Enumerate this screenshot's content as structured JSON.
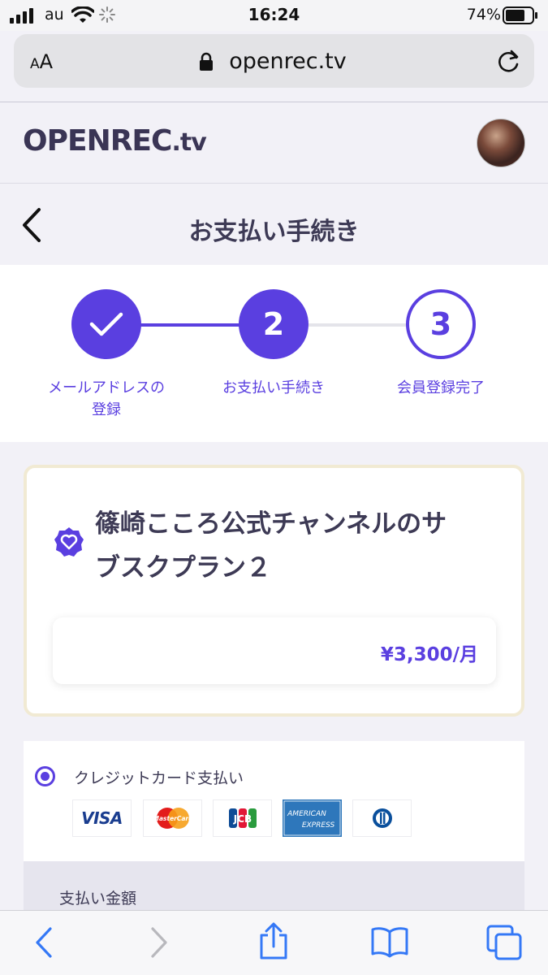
{
  "status_bar": {
    "carrier": "au",
    "time": "16:24",
    "battery_percent": "74%",
    "battery_level": 0.74
  },
  "browser": {
    "text_size_label_small": "A",
    "text_size_label_large": "A",
    "url": "openrec.tv"
  },
  "site": {
    "logo_main": "OPENREC",
    "logo_suffix": ".tv"
  },
  "page": {
    "title": "お支払い手続き"
  },
  "steps": [
    {
      "number": "",
      "label_line1": "メールアドレスの",
      "label_line2": "登録",
      "state": "done"
    },
    {
      "number": "2",
      "label_line1": "お支払い手続き",
      "label_line2": "",
      "state": "current"
    },
    {
      "number": "3",
      "label_line1": "会員登録完了",
      "label_line2": "",
      "state": "todo"
    }
  ],
  "plan": {
    "title_line1": "篠崎こころ公式チャンネルのサ",
    "title_line2": "ブスクプラン２",
    "price": "¥3,300/月"
  },
  "payment": {
    "method_label": "クレジットカード支払い",
    "cards": [
      "VISA",
      "MasterCard",
      "JCB",
      "AMERICAN EXPRESS",
      "Diners Club"
    ],
    "amex_line1": "AMERICAN",
    "amex_line2": "EXPRESS",
    "mc_label": "MasterCard",
    "amount_label": "支払い金額"
  },
  "colors": {
    "accent": "#5a3fe0",
    "text": "#3d3a55",
    "card_border": "#f1ead3"
  },
  "icons": {
    "back": "chevron-left-icon",
    "forward": "chevron-right-icon",
    "share": "share-icon",
    "bookmarks": "book-icon",
    "tabs": "tabs-icon"
  }
}
